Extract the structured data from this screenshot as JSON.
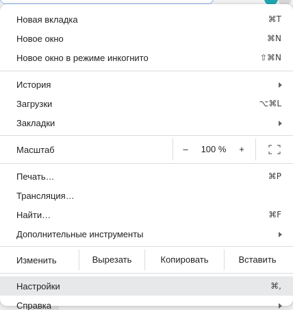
{
  "menu": {
    "new_tab": {
      "label": "Новая вкладка",
      "shortcut": "⌘T"
    },
    "new_window": {
      "label": "Новое окно",
      "shortcut": "⌘N"
    },
    "incognito": {
      "label": "Новое окно в режиме инкогнито",
      "shortcut": "⇧⌘N"
    },
    "history": {
      "label": "История"
    },
    "downloads": {
      "label": "Загрузки",
      "shortcut": "⌥⌘L"
    },
    "bookmarks": {
      "label": "Закладки"
    },
    "zoom": {
      "label": "Масштаб",
      "minus": "–",
      "value": "100 %",
      "plus": "+"
    },
    "print": {
      "label": "Печать…",
      "shortcut": "⌘P"
    },
    "cast": {
      "label": "Трансляция…"
    },
    "find": {
      "label": "Найти…",
      "shortcut": "⌘F"
    },
    "more_tools": {
      "label": "Дополнительные инструменты"
    },
    "edit": {
      "label": "Изменить",
      "cut": "Вырезать",
      "copy": "Копировать",
      "paste": "Вставить"
    },
    "settings": {
      "label": "Настройки",
      "shortcut": "⌘,"
    },
    "help": {
      "label": "Справка"
    }
  },
  "icons": {
    "submenu": "chevron-right-icon",
    "fullscreen": "fullscreen-icon"
  },
  "colors": {
    "highlight": "#e7e8ea",
    "separator": "#dadce0",
    "text": "#1f1f1f"
  }
}
